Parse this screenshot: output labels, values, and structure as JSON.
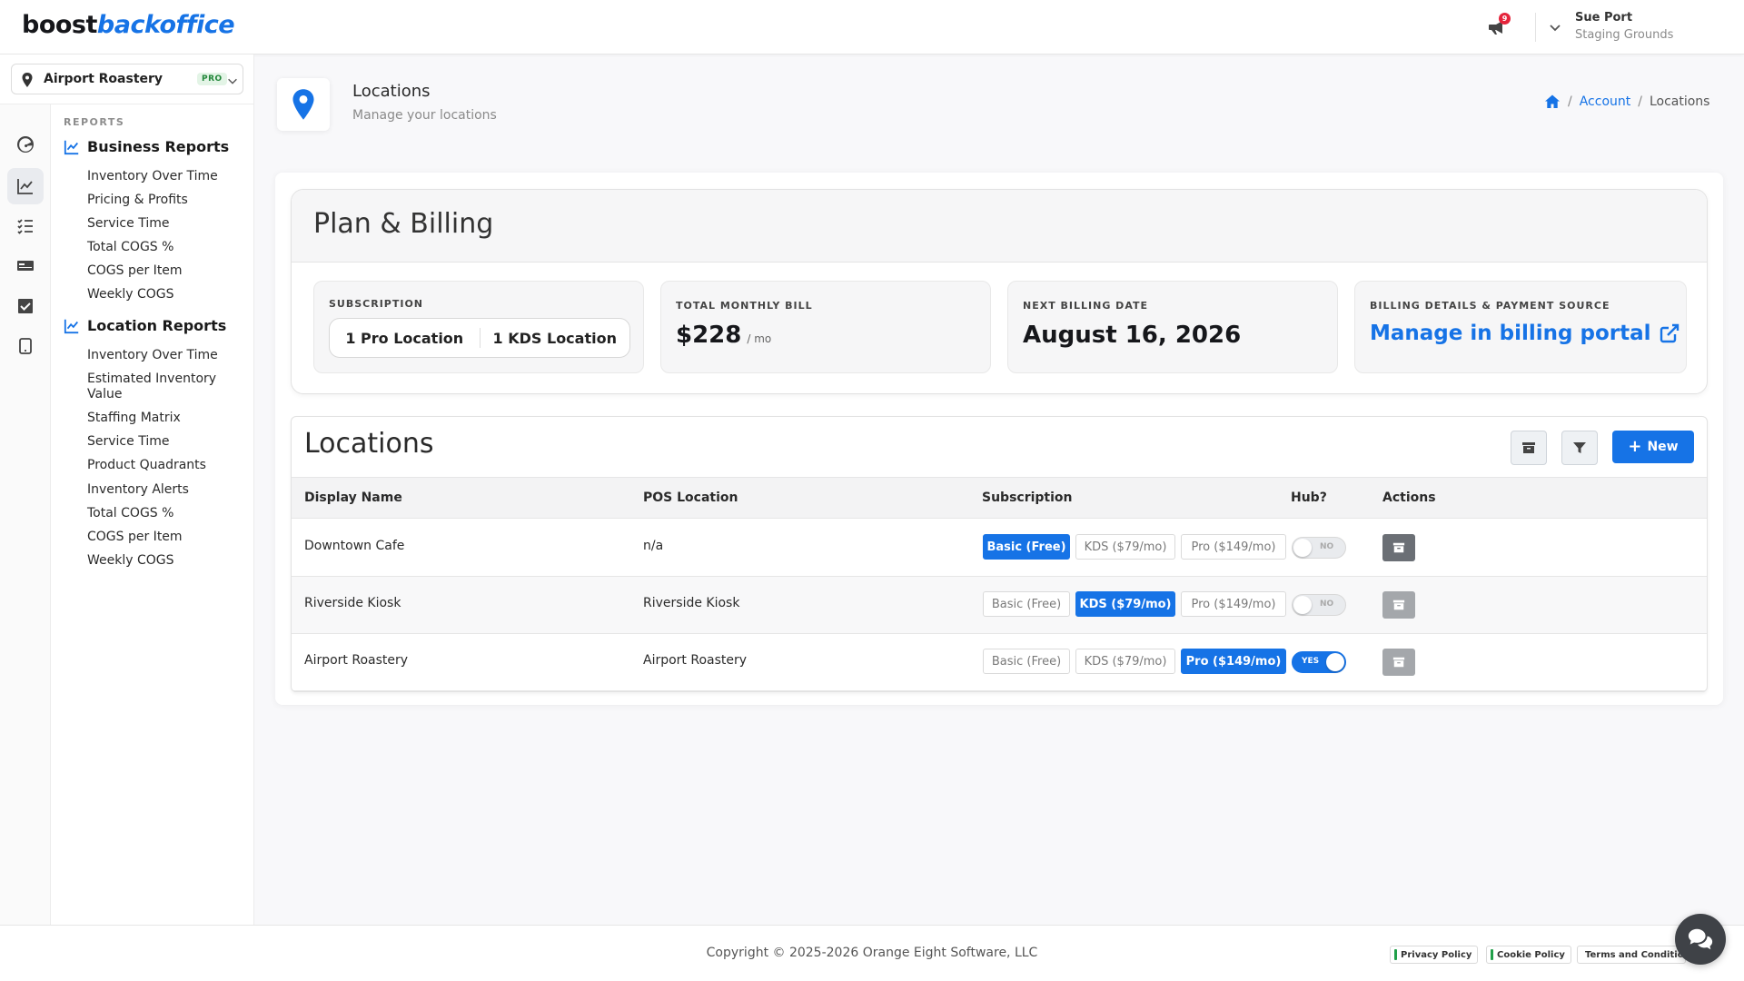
{
  "brand": {
    "part1": "boost",
    "part2": "backoffice"
  },
  "header": {
    "notification_count": "9",
    "user_name": "Sue Port",
    "user_org": "Staging Grounds"
  },
  "location_selector": {
    "name": "Airport Roastery",
    "badge": "PRO"
  },
  "sidebar": {
    "reports_heading": "REPORTS",
    "business_reports": {
      "title": "Business Reports",
      "items": [
        "Inventory Over Time",
        "Pricing & Profits",
        "Service Time",
        "Total COGS %",
        "COGS per Item",
        "Weekly COGS"
      ]
    },
    "location_reports": {
      "title": "Location Reports",
      "items": [
        "Inventory Over Time",
        "Estimated Inventory Value",
        "Staffing Matrix",
        "Service Time",
        "Product Quadrants",
        "Inventory Alerts",
        "Total COGS %",
        "COGS per Item",
        "Weekly COGS"
      ]
    },
    "rail_icons": [
      "dashboard-icon",
      "chart-line-icon",
      "tasks-list-icon",
      "pos-terminal-icon",
      "checkbox-icon",
      "tablet-icon"
    ]
  },
  "page": {
    "title": "Locations",
    "subtitle": "Manage your locations",
    "breadcrumb": {
      "account": "Account",
      "current": "Locations",
      "sep": "/"
    }
  },
  "billing": {
    "title": "Plan & Billing",
    "subscription_label": "SUBSCRIPTION",
    "subscription_pro": "1 Pro Location",
    "subscription_kds": "1 KDS Location",
    "monthly_label": "TOTAL MONTHLY BILL",
    "monthly_value": "$228",
    "monthly_unit": "/ mo",
    "next_label": "NEXT BILLING DATE",
    "next_value": "August 16, 2026",
    "portal_label": "BILLING DETAILS & PAYMENT SOURCE",
    "portal_link": "Manage in billing portal"
  },
  "locations": {
    "title": "Locations",
    "new_button": "New",
    "columns": [
      "Display Name",
      "POS Location",
      "Subscription",
      "Hub?",
      "Actions"
    ],
    "plan_options": [
      "Basic (Free)",
      "KDS ($79/mo)",
      "Pro ($149/mo)"
    ],
    "toggle_on": "YES",
    "toggle_off": "NO",
    "rows": [
      {
        "display_name": "Downtown Cafe",
        "pos_location": "n/a",
        "subscription": "Basic (Free)",
        "hub": false
      },
      {
        "display_name": "Riverside Kiosk",
        "pos_location": "Riverside Kiosk",
        "subscription": "KDS ($79/mo)",
        "hub": false
      },
      {
        "display_name": "Airport Roastery",
        "pos_location": "Airport Roastery",
        "subscription": "Pro ($149/mo)",
        "hub": true
      }
    ]
  },
  "footer": {
    "copyright": "Copyright © 2025-2026 Orange Eight Software, LLC",
    "links": [
      "Privacy Policy",
      "Cookie Policy",
      "Terms and Conditions"
    ]
  },
  "colors": {
    "accent": "#1673e6",
    "badge_red": "#e5243b",
    "policy_green": "#21a04a"
  }
}
